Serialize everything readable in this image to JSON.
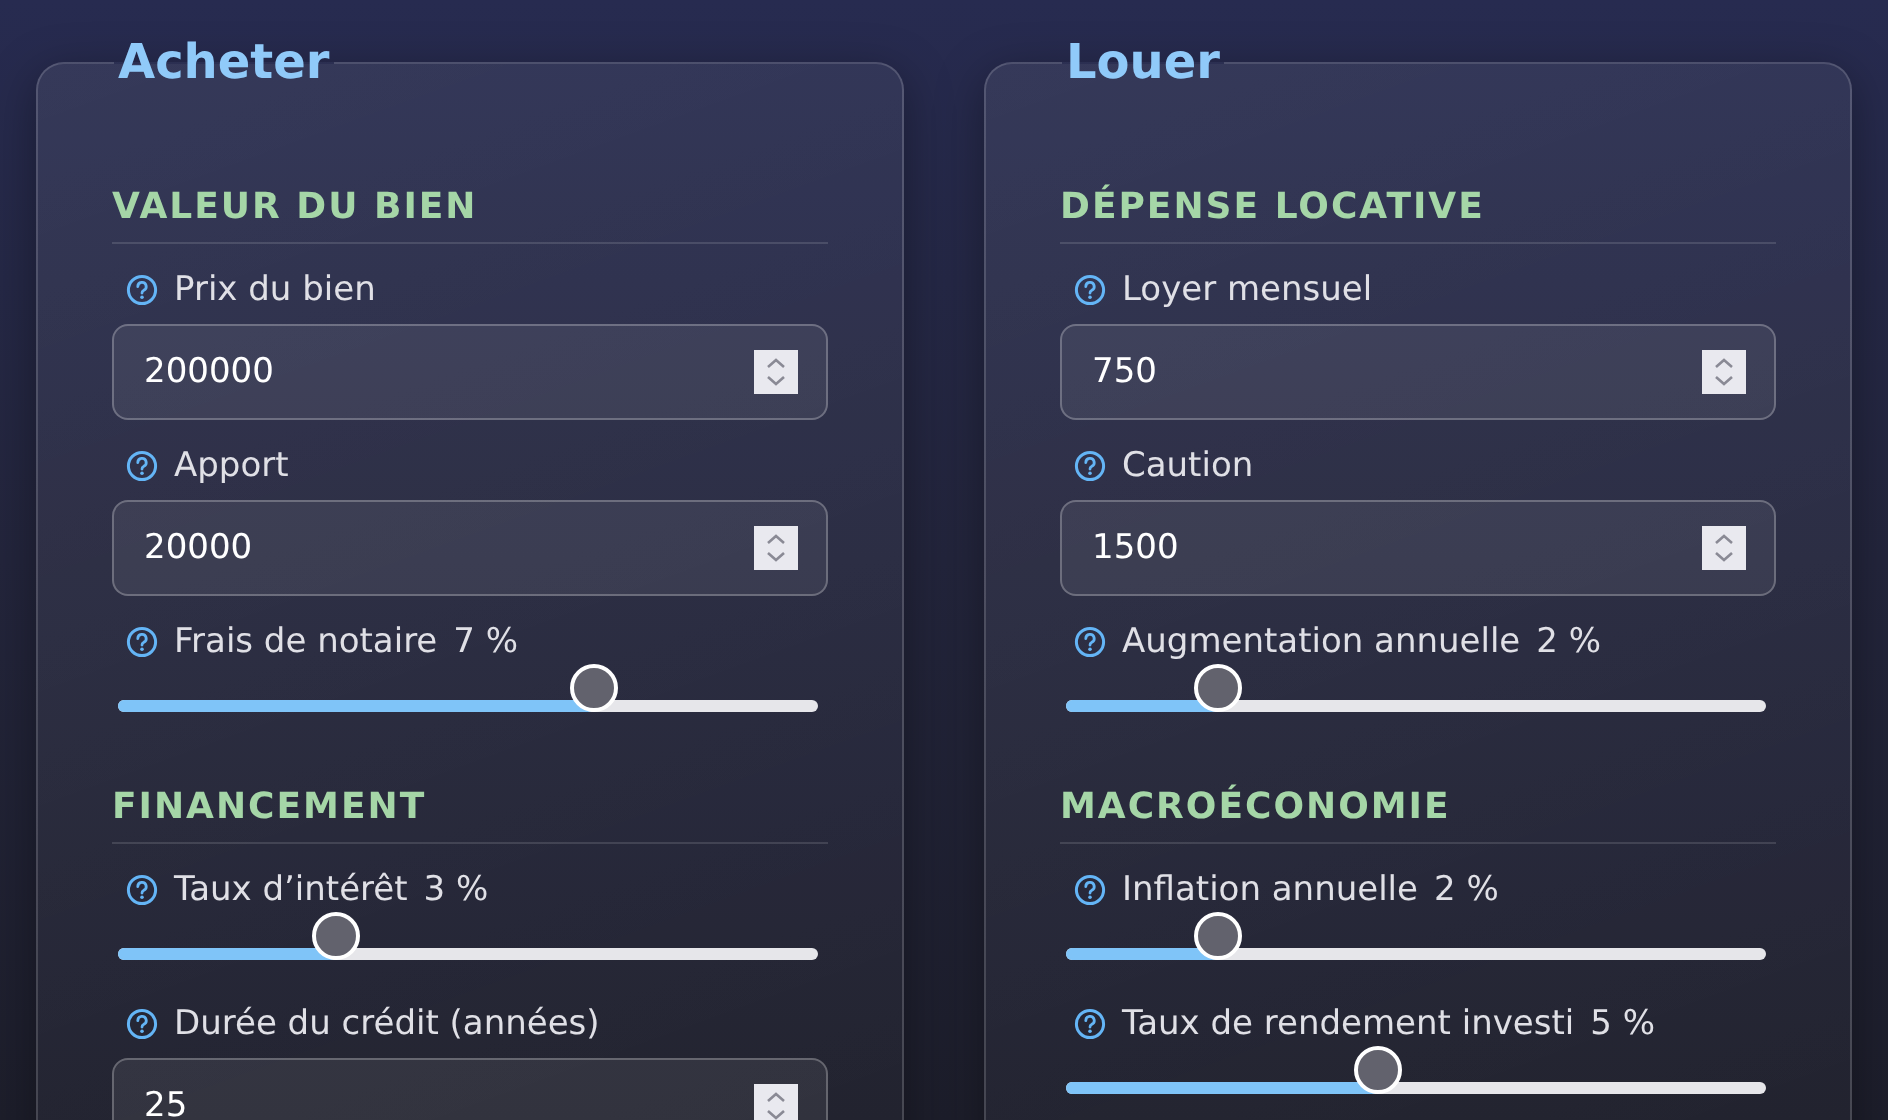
{
  "panels": [
    {
      "title": "Acheter",
      "groups": [
        {
          "heading": "VALEUR DU BIEN",
          "fields": [
            {
              "kind": "number",
              "label": "Prix du bien",
              "value": "200000"
            },
            {
              "kind": "number",
              "label": "Apport",
              "value": "20000"
            },
            {
              "kind": "slider",
              "label": "Frais de notaire",
              "reading": "7 %",
              "level": 0.68
            }
          ]
        },
        {
          "heading": "FINANCEMENT",
          "fields": [
            {
              "kind": "slider",
              "label": "Taux d’intérêt",
              "reading": "3 %",
              "level": 0.31
            },
            {
              "kind": "number",
              "label": "Durée du crédit (années)",
              "value": "25"
            }
          ]
        }
      ]
    },
    {
      "title": "Louer",
      "groups": [
        {
          "heading": "DÉPENSE LOCATIVE",
          "fields": [
            {
              "kind": "number",
              "label": "Loyer mensuel",
              "value": "750"
            },
            {
              "kind": "number",
              "label": "Caution",
              "value": "1500"
            },
            {
              "kind": "slider",
              "label": "Augmentation annuelle",
              "reading": "2 %",
              "level": 0.216
            }
          ]
        },
        {
          "heading": "MACROÉCONOMIE",
          "fields": [
            {
              "kind": "slider",
              "label": "Inflation annuelle",
              "reading": "2 %",
              "level": 0.216
            },
            {
              "kind": "slider",
              "label": "Taux de rendement investi",
              "reading": "5 %",
              "level": 0.446
            }
          ]
        }
      ]
    }
  ]
}
